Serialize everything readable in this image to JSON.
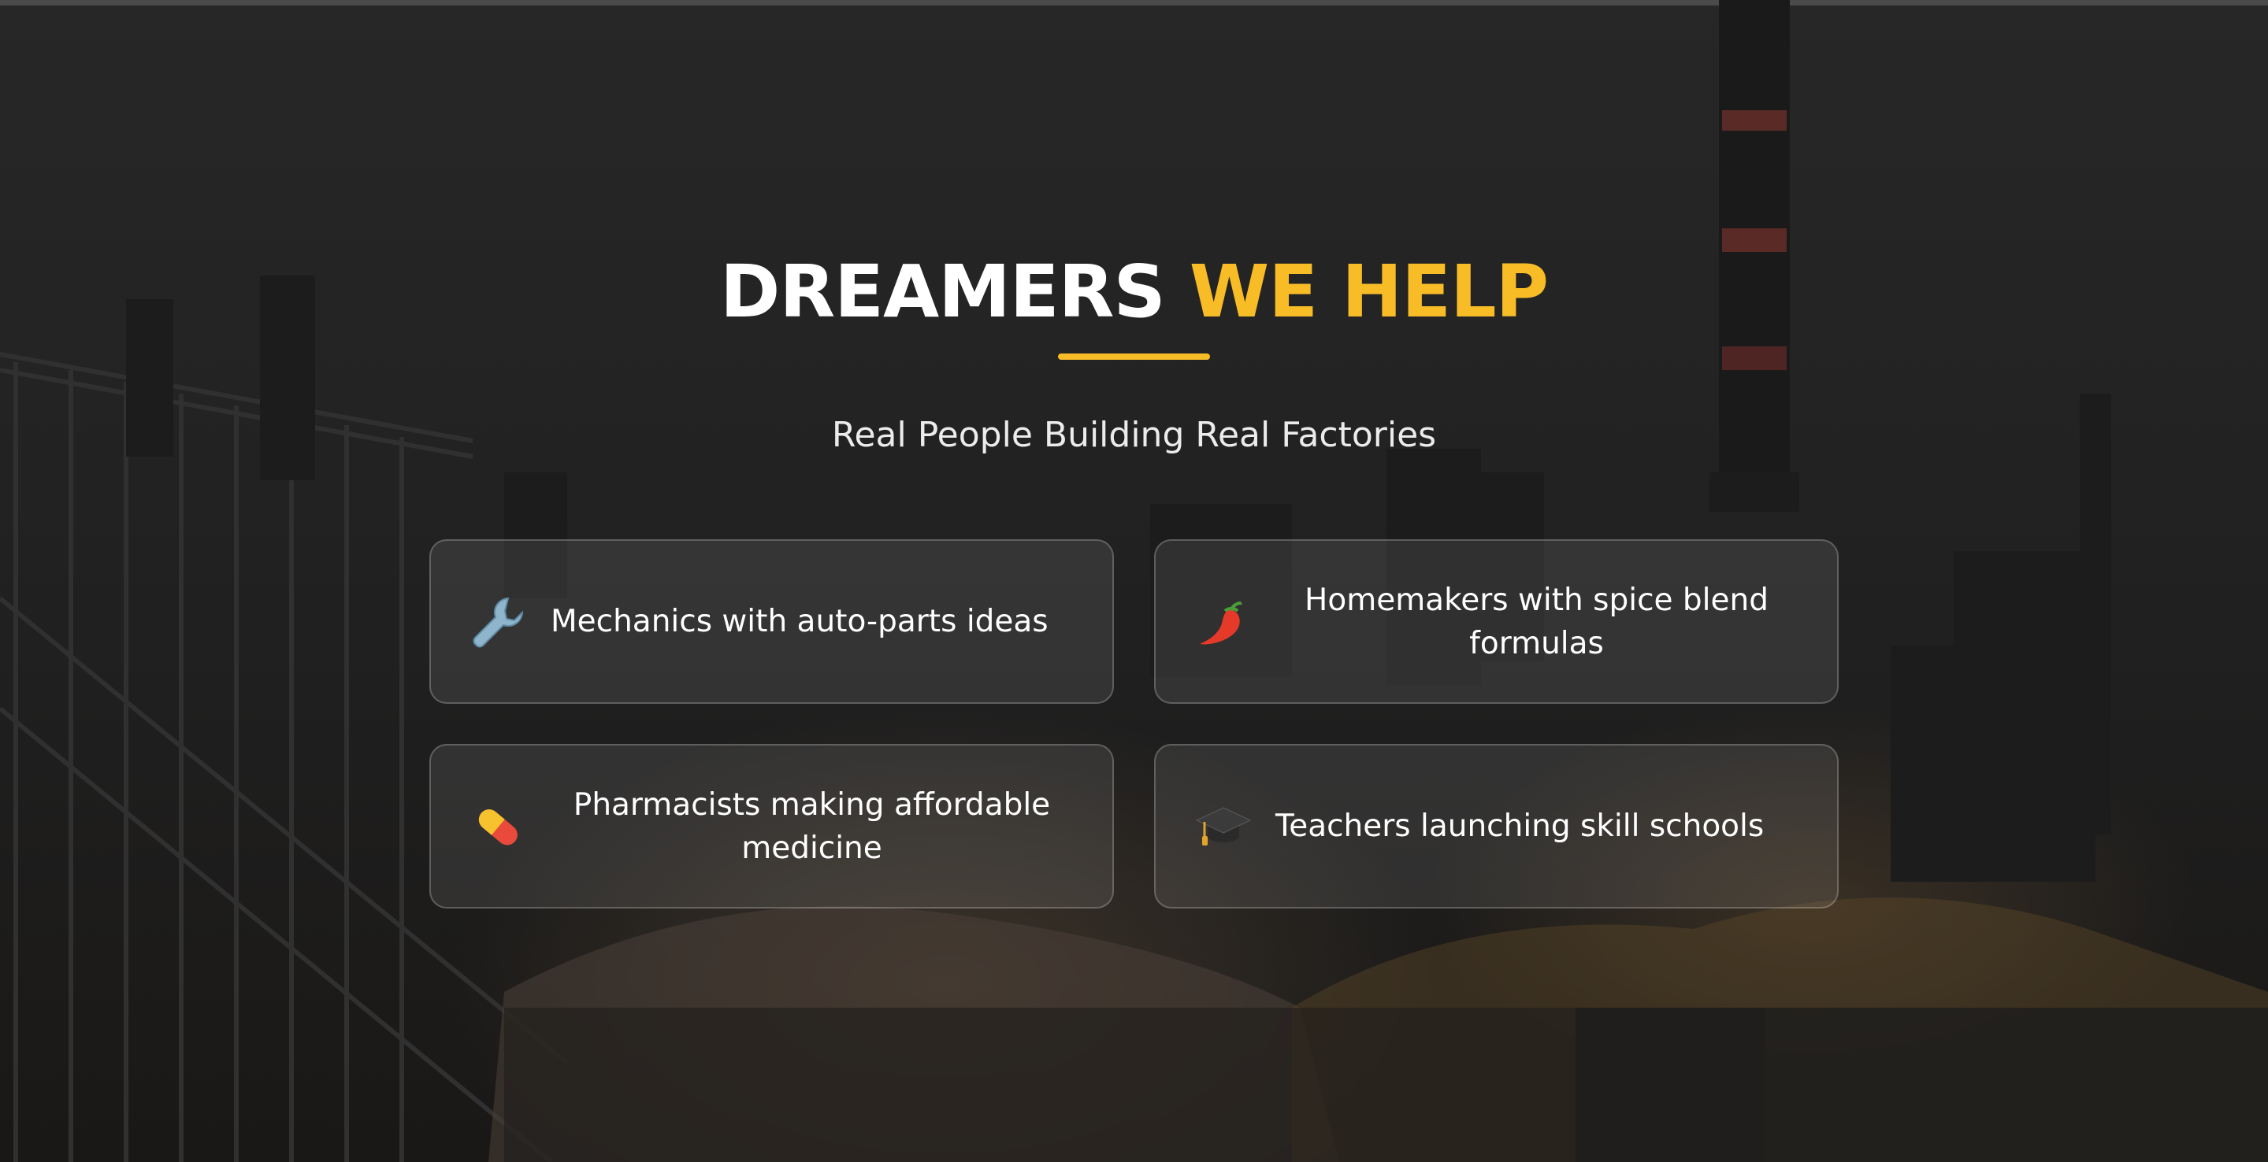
{
  "section": {
    "title_main": "DREAMERS",
    "title_accent": "WE HELP",
    "subtitle": "Real People Building Real Factories"
  },
  "cards": [
    {
      "icon": "wrench-icon",
      "label": "Mechanics with auto-parts ideas"
    },
    {
      "icon": "chili-pepper-icon",
      "label": "Homemakers with spice blend formulas"
    },
    {
      "icon": "pill-icon",
      "label": "Pharmacists making affordable medicine"
    },
    {
      "icon": "graduation-cap-icon",
      "label": "Teachers launching skill schools"
    }
  ],
  "colors": {
    "accent": "#f8bc27",
    "heading": "#ffffff",
    "background": "#232323"
  }
}
